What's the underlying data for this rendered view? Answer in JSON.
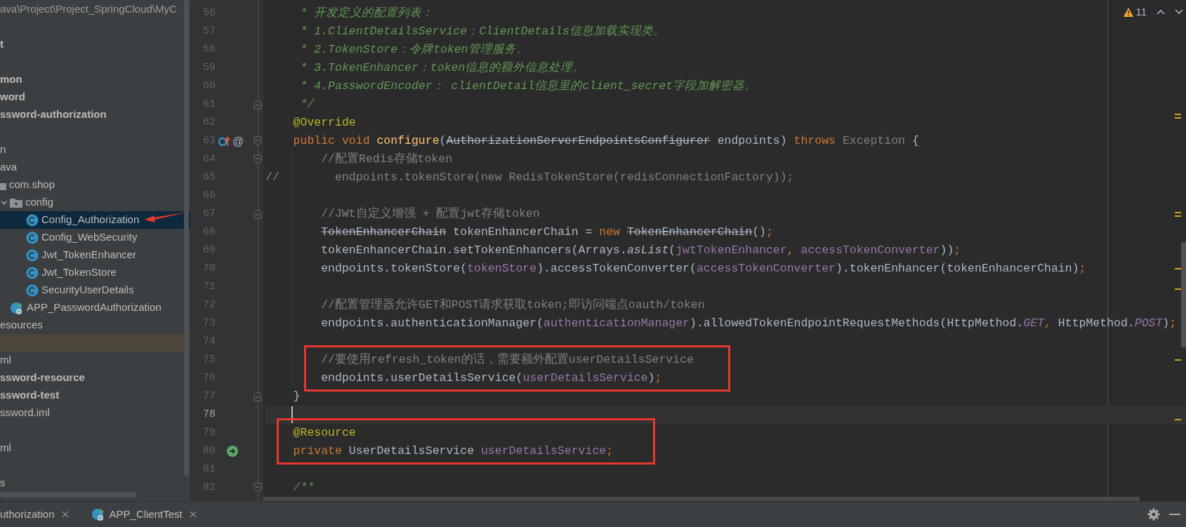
{
  "project_tree": {
    "path": "ava\\Project\\Project_SpringCloud\\MyC",
    "items": [
      {
        "kind": "blank"
      },
      {
        "kind": "plain",
        "label": "t",
        "bold": true,
        "selected": false,
        "highlighted": false
      },
      {
        "kind": "blank"
      },
      {
        "kind": "plain",
        "label": "mon",
        "bold": true,
        "selected": false,
        "highlighted": false
      },
      {
        "kind": "plain",
        "label": "word",
        "bold": true,
        "selected": false,
        "highlighted": false
      },
      {
        "kind": "plain",
        "label": "ssword-authorization",
        "bold": true,
        "selected": false,
        "highlighted": false
      },
      {
        "kind": "blank"
      },
      {
        "kind": "plain",
        "label": "n",
        "bold": false,
        "selected": false,
        "highlighted": false
      },
      {
        "kind": "plain",
        "label": "ava",
        "bold": false,
        "selected": false,
        "highlighted": false
      },
      {
        "kind": "package",
        "label": "com.shop",
        "bold": false,
        "selected": false,
        "highlighted": false,
        "children": [
          {
            "kind": "folder",
            "label": "config",
            "bold": false,
            "expanded": true,
            "selected": false,
            "highlighted": false,
            "children": [
              {
                "kind": "class",
                "label": "Config_Authorization",
                "bold": false,
                "selected": true,
                "highlighted": false
              },
              {
                "kind": "class",
                "label": "Config_WebSecurity",
                "bold": false,
                "selected": false,
                "highlighted": false
              },
              {
                "kind": "class",
                "label": "Jwt_TokenEnhancer",
                "bold": false,
                "selected": false,
                "highlighted": false
              },
              {
                "kind": "class",
                "label": "Jwt_TokenStore",
                "bold": false,
                "selected": false,
                "highlighted": false
              },
              {
                "kind": "class",
                "label": "SecurityUserDetails",
                "bold": false,
                "selected": false,
                "highlighted": false
              }
            ]
          },
          {
            "kind": "app",
            "label": "APP_PasswordAuthorization",
            "bold": false,
            "selected": false,
            "highlighted": false
          }
        ]
      },
      {
        "kind": "plain",
        "label": "esources",
        "bold": false,
        "selected": false,
        "highlighted": false
      },
      {
        "kind": "blank",
        "highlighted": true
      },
      {
        "kind": "plain",
        "label": "ml",
        "bold": false,
        "selected": false,
        "highlighted": false
      },
      {
        "kind": "plain",
        "label": "ssword-resource",
        "bold": true,
        "selected": false,
        "highlighted": false
      },
      {
        "kind": "plain",
        "label": "ssword-test",
        "bold": true,
        "selected": false,
        "highlighted": false
      },
      {
        "kind": "plain",
        "label": "ssword.iml",
        "bold": false,
        "selected": false,
        "highlighted": false
      },
      {
        "kind": "blank"
      },
      {
        "kind": "plain",
        "label": "ml",
        "bold": false,
        "selected": false,
        "highlighted": false
      },
      {
        "kind": "blank"
      },
      {
        "kind": "plain",
        "label": "s",
        "bold": false,
        "selected": false,
        "highlighted": false
      }
    ]
  },
  "editor": {
    "warnings": {
      "count": "11"
    },
    "lines": [
      {
        "number": "56",
        "current": false,
        "boxed": false,
        "tokens": [
          {
            "kind": "doc",
            "text": "     * 开发定义的配置列表："
          }
        ]
      },
      {
        "number": "57",
        "current": false,
        "boxed": false,
        "tokens": [
          {
            "kind": "doc",
            "text": "     * 1.ClientDetailsService：ClientDetails信息加载实现类。"
          }
        ]
      },
      {
        "number": "58",
        "current": false,
        "boxed": false,
        "tokens": [
          {
            "kind": "doc",
            "text": "     * 2.TokenStore：令牌token管理服务。"
          }
        ]
      },
      {
        "number": "59",
        "current": false,
        "boxed": false,
        "tokens": [
          {
            "kind": "doc",
            "text": "     * 3.TokenEnhancer：token信息的额外信息处理。"
          }
        ]
      },
      {
        "number": "60",
        "current": false,
        "boxed": false,
        "tokens": [
          {
            "kind": "doc",
            "text": "     * 4.PasswordEncoder： clientDetail信息里的client_secret字段加解密器。"
          }
        ]
      },
      {
        "number": "61",
        "current": false,
        "boxed": false,
        "gutter_marks": [
          {
            "kind": "fold_end"
          }
        ],
        "tokens": [
          {
            "kind": "doc",
            "text": "     */"
          }
        ]
      },
      {
        "number": "62",
        "current": false,
        "boxed": false,
        "tokens": [
          {
            "kind": "annotation",
            "text": "    @Override"
          }
        ]
      },
      {
        "number": "63",
        "current": false,
        "boxed": false,
        "gutter_marks": [
          {
            "kind": "override"
          },
          {
            "kind": "implementation",
            "text": "@"
          },
          {
            "kind": "fold_start"
          }
        ],
        "tokens": [
          {
            "kind": "keyword",
            "text": "    public void "
          },
          {
            "kind": "method",
            "text": "configure"
          },
          {
            "kind": "plain",
            "text": "("
          },
          {
            "kind": "deprecated",
            "text": "AuthorizationServerEndpointsConfigurer"
          },
          {
            "kind": "plain",
            "text": " endpoints) "
          },
          {
            "kind": "keyword",
            "text": "throws "
          },
          {
            "kind": "unused",
            "text": "Exception"
          },
          {
            "kind": "plain",
            "text": " {"
          }
        ]
      },
      {
        "number": "64",
        "current": false,
        "boxed": false,
        "gutter_marks": [
          {
            "kind": "fold_start"
          }
        ],
        "tokens": [
          {
            "kind": "comment",
            "text": "        //配置Redis存储token"
          }
        ]
      },
      {
        "number": "65",
        "current": false,
        "boxed": false,
        "tokens": [
          {
            "kind": "comment",
            "text": "//        endpoints.tokenStore(new RedisTokenStore(redisConnectionFactory));"
          }
        ]
      },
      {
        "number": "66",
        "current": false,
        "boxed": false
      },
      {
        "number": "67",
        "current": false,
        "boxed": false,
        "gutter_marks": [
          {
            "kind": "fold_end"
          }
        ],
        "tokens": [
          {
            "kind": "comment",
            "text": "        //JWt自定义增强 + 配置jwt存储token"
          }
        ]
      },
      {
        "number": "68",
        "current": false,
        "boxed": false,
        "tokens": [
          {
            "kind": "deprecated",
            "text": "        TokenEnhancerChain"
          },
          {
            "kind": "plain",
            "text": " tokenEnhancerChain = "
          },
          {
            "kind": "keyword",
            "text": "new "
          },
          {
            "kind": "deprecated",
            "text": "TokenEnhancerChain"
          },
          {
            "kind": "plain",
            "text": "()"
          },
          {
            "kind": "keyword",
            "text": ";"
          }
        ]
      },
      {
        "number": "69",
        "current": false,
        "boxed": false,
        "tokens": [
          {
            "kind": "plain",
            "text": "        tokenEnhancerChain.setTokenEnhancers(Arrays."
          },
          {
            "kind": "static",
            "text": "asList"
          },
          {
            "kind": "plain",
            "text": "("
          },
          {
            "kind": "field",
            "text": "jwtTokenEnhancer"
          },
          {
            "kind": "keyword",
            "text": ", "
          },
          {
            "kind": "field",
            "text": "accessTokenConverter"
          },
          {
            "kind": "plain",
            "text": "))"
          },
          {
            "kind": "keyword",
            "text": ";"
          }
        ]
      },
      {
        "number": "70",
        "current": false,
        "boxed": false,
        "tokens": [
          {
            "kind": "plain",
            "text": "        endpoints.tokenStore("
          },
          {
            "kind": "field",
            "text": "tokenStore"
          },
          {
            "kind": "plain",
            "text": ").accessTokenConverter("
          },
          {
            "kind": "field",
            "text": "accessTokenConverter"
          },
          {
            "kind": "plain",
            "text": ").tokenEnhancer(tokenEnhancerChain)"
          },
          {
            "kind": "keyword",
            "text": ";"
          }
        ]
      },
      {
        "number": "71",
        "current": false,
        "boxed": false
      },
      {
        "number": "72",
        "current": false,
        "boxed": false,
        "tokens": [
          {
            "kind": "comment",
            "text": "        //配置管理器允许GET和POST请求获取token;即访问端点oauth/token"
          }
        ]
      },
      {
        "number": "73",
        "current": false,
        "boxed": false,
        "tokens": [
          {
            "kind": "plain",
            "text": "        endpoints.authenticationManager("
          },
          {
            "kind": "field",
            "text": "authenticationManager"
          },
          {
            "kind": "plain",
            "text": ").allowedTokenEndpointRequestMethods(HttpMethod."
          },
          {
            "kind": "field_italic",
            "text": "GET"
          },
          {
            "kind": "keyword",
            "text": ", "
          },
          {
            "kind": "plain",
            "text": "HttpMethod."
          },
          {
            "kind": "field_italic",
            "text": "POST"
          },
          {
            "kind": "plain",
            "text": ")"
          },
          {
            "kind": "keyword",
            "text": ";"
          }
        ]
      },
      {
        "number": "74",
        "current": false,
        "boxed": false
      },
      {
        "number": "75",
        "current": false,
        "boxed": true,
        "tokens": [
          {
            "kind": "comment",
            "text": "        //要使用refresh_token的话，需要额外配置userDetailsService"
          }
        ]
      },
      {
        "number": "76",
        "current": false,
        "boxed": true,
        "tokens": [
          {
            "kind": "plain",
            "text": "        endpoints.userDetailsService("
          },
          {
            "kind": "field",
            "text": "userDetailsService"
          },
          {
            "kind": "plain",
            "text": ")"
          },
          {
            "kind": "keyword",
            "text": ";"
          }
        ]
      },
      {
        "number": "77",
        "current": false,
        "boxed": false,
        "gutter_marks": [
          {
            "kind": "fold_end"
          }
        ],
        "tokens": [
          {
            "kind": "plain",
            "text": "    }"
          }
        ]
      },
      {
        "number": "78",
        "current": true,
        "boxed": false
      },
      {
        "number": "79",
        "current": false,
        "boxed": true,
        "tokens": [
          {
            "kind": "annotation",
            "text": "    @Resource"
          }
        ]
      },
      {
        "number": "80",
        "current": false,
        "boxed": true,
        "gutter_marks": [
          {
            "kind": "bean"
          }
        ],
        "tokens": [
          {
            "kind": "keyword",
            "text": "    private "
          },
          {
            "kind": "plain",
            "text": "UserDetailsService "
          },
          {
            "kind": "field",
            "text": "userDetailsService"
          },
          {
            "kind": "keyword",
            "text": ";"
          }
        ]
      },
      {
        "number": "81",
        "current": false,
        "boxed": false
      },
      {
        "number": "82",
        "current": false,
        "boxed": false,
        "gutter_marks": [
          {
            "kind": "fold_start"
          }
        ],
        "tokens": [
          {
            "kind": "doc",
            "text": "    /**"
          }
        ]
      }
    ]
  },
  "bottom_tabs": [
    {
      "kind": "text",
      "label": "uthorization"
    },
    {
      "kind": "app",
      "label": "APP_ClientTest"
    }
  ]
}
